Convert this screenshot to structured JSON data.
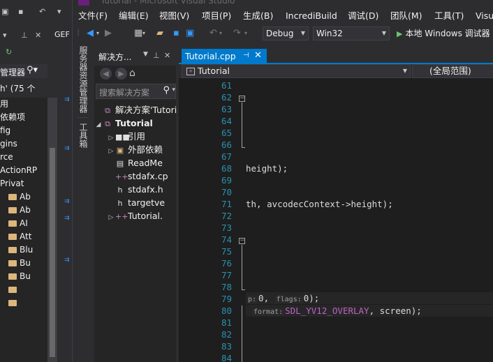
{
  "window": {
    "title": "Tutorial - Microsoft Visual Studio"
  },
  "background_window": {
    "tab_label": "GEF",
    "side_text": "C",
    "search_label": "管理器",
    "solution_text": "h' (75 个",
    "tree": [
      {
        "label": "用",
        "folder": false
      },
      {
        "label": "依赖项",
        "folder": false
      },
      {
        "label": "fig",
        "folder": false
      },
      {
        "label": "gins",
        "folder": false
      },
      {
        "label": "rce",
        "folder": false
      },
      {
        "label": "ActionRP",
        "folder": false
      },
      {
        "label": "Privat",
        "folder": false
      },
      {
        "label": "Ab",
        "folder": true
      },
      {
        "label": "Ab",
        "folder": true
      },
      {
        "label": "AI",
        "folder": true
      },
      {
        "label": "Att",
        "folder": true
      },
      {
        "label": "Blu",
        "folder": true
      },
      {
        "label": "Bu",
        "folder": true
      },
      {
        "label": "Bu",
        "folder": true
      },
      {
        "label": "",
        "folder": true
      },
      {
        "label": "",
        "folder": true
      }
    ]
  },
  "menu": {
    "items": [
      "文件(F)",
      "编辑(E)",
      "视图(V)",
      "项目(P)",
      "生成(B)",
      "IncrediBuild",
      "调试(D)",
      "团队(M)",
      "工具(T)",
      "Visu"
    ]
  },
  "toolbar": {
    "config": "Debug",
    "platform": "Win32",
    "run_label": "本地 Windows 调试器"
  },
  "side_tabs": {
    "server_explorer": "服务器资源管理器",
    "toolbox": "工具箱"
  },
  "solution_explorer": {
    "title": "解决方...",
    "search_placeholder": "搜索解决方案",
    "tree": [
      {
        "label": "解决方案'Tutori",
        "icon": "solution-icon",
        "glyph": "⧉",
        "cls": "ic-sol",
        "expander": "",
        "indent": 0,
        "bold": false
      },
      {
        "label": "Tutorial",
        "icon": "project-icon",
        "glyph": "⧉",
        "cls": "ic-proj",
        "expander": "◢",
        "indent": 0,
        "bold": true
      },
      {
        "label": "引用",
        "icon": "references-icon",
        "glyph": "■■",
        "cls": "ic-ref",
        "expander": "▷",
        "indent": 1,
        "bold": false
      },
      {
        "label": "外部依赖",
        "icon": "external-deps-icon",
        "glyph": "▣",
        "cls": "ic-ext",
        "expander": "▷",
        "indent": 1,
        "bold": false
      },
      {
        "label": "ReadMe",
        "icon": "text-file-icon",
        "glyph": "▤",
        "cls": "ic-file",
        "expander": "",
        "indent": 1,
        "bold": false
      },
      {
        "label": "stdafx.cp",
        "icon": "cpp-file-icon",
        "glyph": "++",
        "cls": "ic-cpp",
        "expander": "",
        "indent": 1,
        "bold": false
      },
      {
        "label": "stdafx.h",
        "icon": "header-file-icon",
        "glyph": "h",
        "cls": "ic-file",
        "expander": "",
        "indent": 1,
        "bold": false
      },
      {
        "label": "targetve",
        "icon": "header-file-icon",
        "glyph": "h",
        "cls": "ic-file",
        "expander": "",
        "indent": 1,
        "bold": false
      },
      {
        "label": "Tutorial.",
        "icon": "cpp-file-icon",
        "glyph": "++",
        "cls": "ic-cpp",
        "expander": "▷",
        "indent": 1,
        "bold": false
      }
    ]
  },
  "editor": {
    "tab_label": "Tutorial.cpp",
    "nav_left": "Tutorial",
    "nav_right": "(全局范围)",
    "lines": [
      {
        "num": "61",
        "text": ""
      },
      {
        "num": "62",
        "text": ""
      },
      {
        "num": "63",
        "text": ""
      },
      {
        "num": "64",
        "text": ""
      },
      {
        "num": "65",
        "text": ""
      },
      {
        "num": "66",
        "text": ""
      },
      {
        "num": "67",
        "text": ""
      },
      {
        "num": "68",
        "text": "height);"
      },
      {
        "num": "69",
        "text": ""
      },
      {
        "num": "70",
        "text": ""
      },
      {
        "num": "71",
        "text": "th, avcodecContext->height);"
      },
      {
        "num": "72",
        "text": ""
      },
      {
        "num": "73",
        "text": ""
      },
      {
        "num": "74",
        "text": ""
      },
      {
        "num": "75",
        "text": ""
      },
      {
        "num": "76",
        "text": ""
      },
      {
        "num": "77",
        "text": ""
      },
      {
        "num": "78",
        "text": ""
      },
      {
        "num": "79",
        "text": ""
      },
      {
        "num": "80",
        "text": ""
      },
      {
        "num": "81",
        "text": ""
      },
      {
        "num": "82",
        "text": ""
      },
      {
        "num": "83",
        "text": ""
      },
      {
        "num": "84",
        "text": ""
      }
    ],
    "line79": {
      "hint1": "p:",
      "val1": "0, ",
      "hint2": "flags:",
      "val2": "0);"
    },
    "line80": {
      "hint": "format:",
      "macro": "SDL_YV12_OVERLAY",
      "rest": ", screen);"
    }
  }
}
